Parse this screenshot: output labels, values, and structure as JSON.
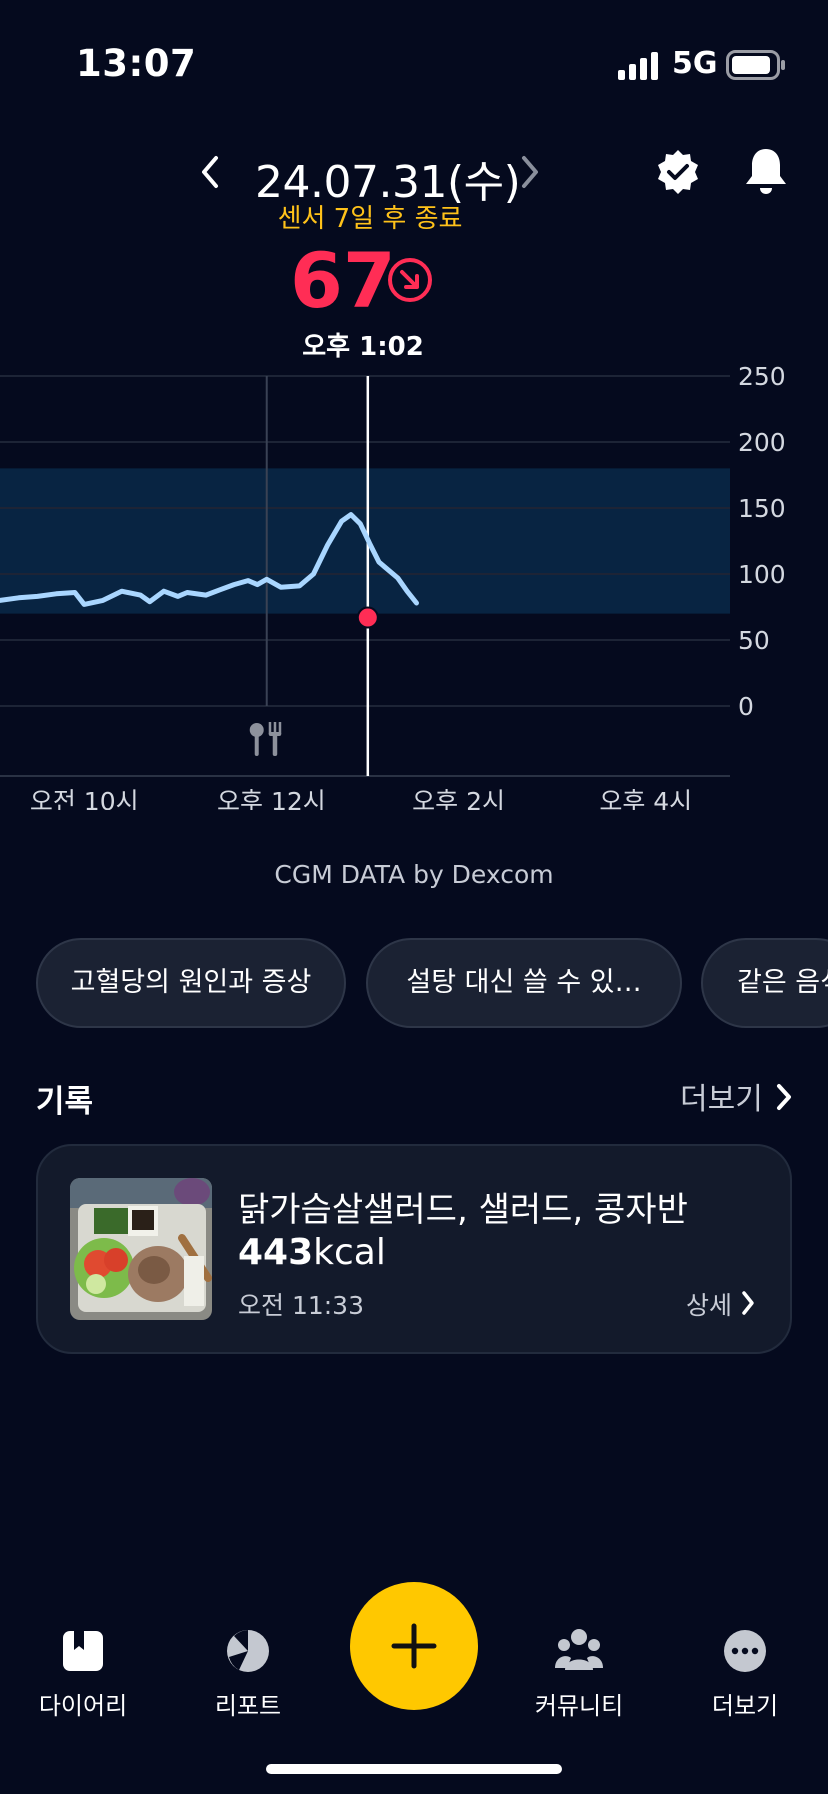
{
  "status_bar": {
    "time": "13:07",
    "network": "5G"
  },
  "header": {
    "date": "24.07.31(수)",
    "sensor_note": "센서 7일 후 종료",
    "glucose_value": "67",
    "reading_time": "오후 1:02"
  },
  "chart_data": {
    "type": "line",
    "y_ticks": [
      "250",
      "200",
      "150",
      "100",
      "50",
      "0"
    ],
    "ylim": [
      0,
      250
    ],
    "target_range": [
      70,
      180
    ],
    "x_tick_labels": [
      "오전 10시",
      "오후 12시",
      "오후 2시",
      "오후 4시"
    ],
    "x_range_hours": [
      9.1,
      16.9
    ],
    "series": [
      {
        "x": [
          9.1,
          9.3,
          9.5,
          9.7,
          9.9,
          10.0,
          10.2,
          10.4,
          10.6,
          10.7,
          10.85,
          11.0,
          11.1,
          11.3,
          11.45,
          11.6,
          11.75,
          11.85,
          11.95,
          12.1,
          12.3,
          12.45,
          12.6,
          12.75,
          12.85,
          12.95,
          13.05,
          13.15,
          13.35,
          13.45,
          13.55
        ],
        "y": [
          80,
          82,
          83,
          85,
          86,
          77,
          80,
          87,
          84,
          79,
          87,
          83,
          86,
          84,
          88,
          92,
          95,
          92,
          96,
          90,
          91,
          100,
          122,
          140,
          145,
          138,
          123,
          109,
          97,
          87,
          78
        ]
      }
    ],
    "current_point": {
      "x": 13.03,
      "y": 67
    },
    "meal_marker_x": 11.95
  },
  "source_label": "CGM DATA by Dexcom",
  "chips": [
    "고혈당의 원인과 증상",
    "설탕 대신 쓸 수 있…",
    "같은 음식"
  ],
  "records": {
    "title": "기록",
    "more_label": "더보기",
    "item": {
      "name": "닭가슴살샐러드, 샐러드, 콩자반",
      "kcal_value": "443",
      "kcal_unit": "kcal",
      "time": "오전 11:33",
      "detail_label": "상세"
    }
  },
  "tabs": [
    {
      "label": "다이어리",
      "icon": "diary-icon"
    },
    {
      "label": "리포트",
      "icon": "report-icon"
    },
    {
      "label": "커뮤니티",
      "icon": "community-icon"
    },
    {
      "label": "더보기",
      "icon": "more-icon"
    }
  ],
  "colors": {
    "accent": "#ffc800",
    "glucose": "#ff2d55",
    "line": "#a9d6ff",
    "target_band": "#082442"
  }
}
